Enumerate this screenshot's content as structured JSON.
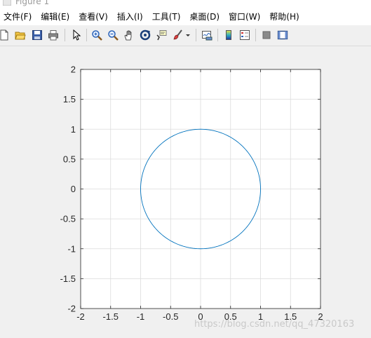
{
  "window": {
    "title": "Figure 1"
  },
  "menu": [
    {
      "label": "文件(F)",
      "name": "menu-file"
    },
    {
      "label": "编辑(E)",
      "name": "menu-edit"
    },
    {
      "label": "查看(V)",
      "name": "menu-view"
    },
    {
      "label": "插入(I)",
      "name": "menu-insert"
    },
    {
      "label": "工具(T)",
      "name": "menu-tools"
    },
    {
      "label": "桌面(D)",
      "name": "menu-desktop"
    },
    {
      "label": "窗口(W)",
      "name": "menu-window"
    },
    {
      "label": "帮助(H)",
      "name": "menu-help"
    }
  ],
  "toolbar": {
    "icons": [
      "new-file-icon",
      "open-folder-icon",
      "save-icon",
      "print-icon",
      "select-arrow-icon",
      "zoom-in-icon",
      "zoom-out-icon",
      "pan-hand-icon",
      "rotate-3d-icon",
      "data-cursor-icon",
      "brush-icon",
      "brush-dropdown-icon",
      "link-plot-icon",
      "colorbar-icon",
      "legend-icon",
      "hide-plot-tools-icon",
      "show-plot-tools-icon"
    ]
  },
  "colors": {
    "line": "#0072bd",
    "grid": "#dcdcdc",
    "axes": "#262626",
    "background": "#ffffff",
    "figure": "#f0f0f0"
  },
  "chart_data": {
    "type": "line",
    "title": "",
    "xlabel": "",
    "ylabel": "",
    "xlim": [
      -2,
      2
    ],
    "ylim": [
      -2,
      2
    ],
    "xticks": [
      -2,
      -1.5,
      -1,
      -0.5,
      0,
      0.5,
      1,
      1.5,
      2
    ],
    "yticks": [
      -2,
      -1.5,
      -1,
      -0.5,
      0,
      0.5,
      1,
      1.5,
      2
    ],
    "xtick_labels": [
      "-2",
      "-1.5",
      "-1",
      "-0.5",
      "0",
      "0.5",
      "1",
      "1.5",
      "2"
    ],
    "ytick_labels": [
      "-2",
      "-1.5",
      "-1",
      "-0.5",
      "0",
      "0.5",
      "1",
      "1.5",
      "2"
    ],
    "grid": true,
    "series": [
      {
        "shape": "circle",
        "center": [
          0,
          0
        ],
        "radius": 1
      }
    ]
  },
  "watermark": "https://blog.csdn.net/qq_47320163"
}
